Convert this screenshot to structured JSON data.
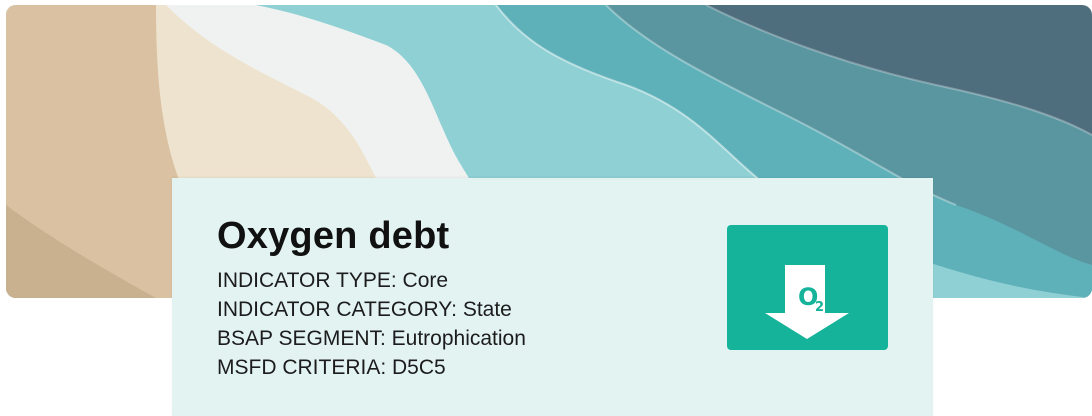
{
  "indicator": {
    "title": "Oxygen debt",
    "fields": [
      {
        "label": "INDICATOR TYPE",
        "value": "Core",
        "text": "INDICATOR TYPE: Core"
      },
      {
        "label": "INDICATOR CATEGORY",
        "value": "State",
        "text": "INDICATOR CATEGORY: State"
      },
      {
        "label": "BSAP SEGMENT",
        "value": "Eutrophication",
        "text": "BSAP SEGMENT: Eutrophication"
      },
      {
        "label": "MSFD CRITERIA",
        "value": "D5C5",
        "text": "MSFD CRITERIA: D5C5"
      }
    ],
    "icon": {
      "name": "oxygen-decrease-icon",
      "glyph": "O",
      "subscript": "2",
      "background": "#15b39a"
    }
  },
  "banner": {
    "name": "layered-waves-banner",
    "colors": [
      "#d9c1a1",
      "#eee3cf",
      "#f0f2f1",
      "#8ed0d4",
      "#5fb1b9",
      "#5a96a0",
      "#4e6e7e"
    ]
  },
  "card": {
    "background": "#e2f3f2"
  }
}
